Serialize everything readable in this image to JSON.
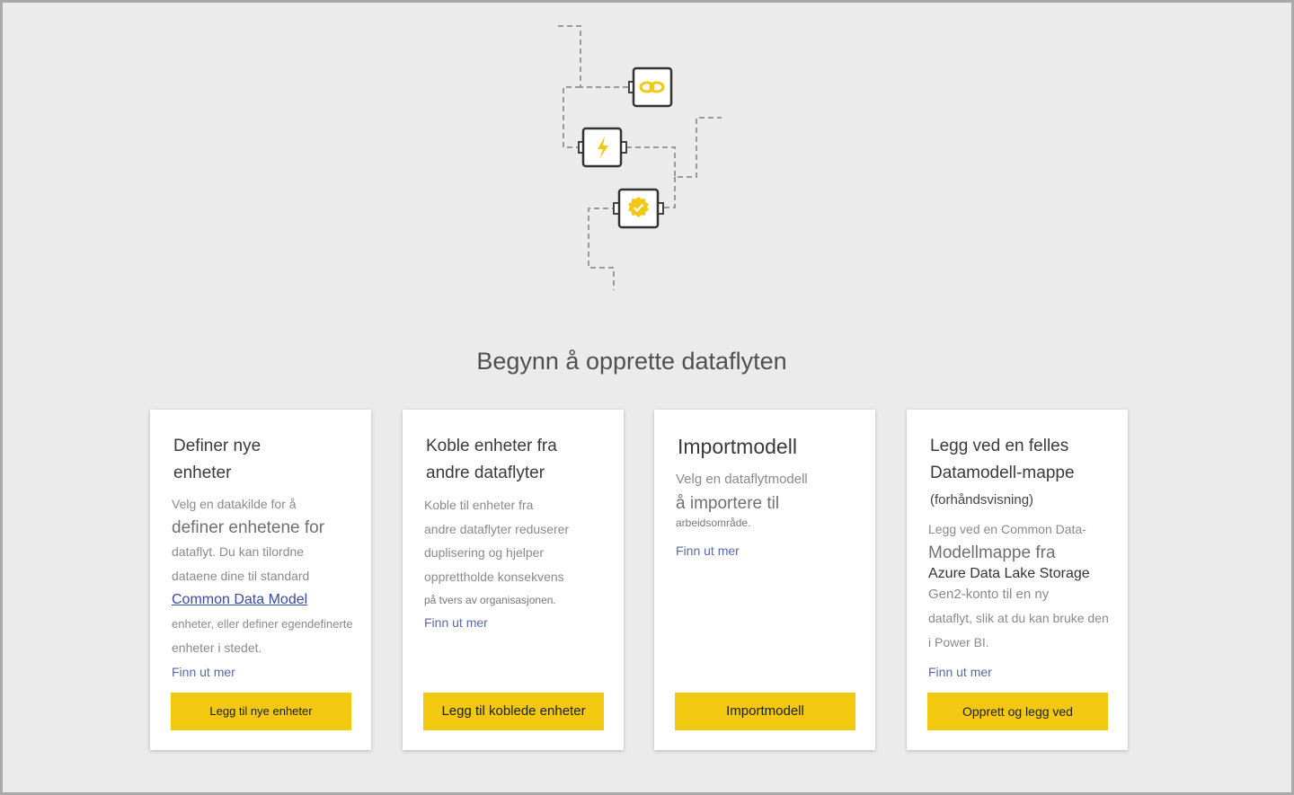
{
  "page": {
    "heading": "Begynn å opprette dataflyten"
  },
  "illustration": {
    "nodes": [
      {
        "icon": "link-icon"
      },
      {
        "icon": "lightning-icon"
      },
      {
        "icon": "checkmark-badge-icon"
      }
    ],
    "accent_color": "#f2c811"
  },
  "cards": [
    {
      "title": "Definer nye enheter",
      "desc_1": "Velg en datakilde for å",
      "desc_2": "definer enhetene for",
      "desc_3": "dataflyt. Du kan tilordne",
      "desc_4": "dataene dine til standard",
      "link_cdm": "Common Data Model",
      "desc_5": "enheter, eller definer egendefinerte",
      "desc_6": "enheter i stedet.",
      "learn_more": "Finn ut mer",
      "button": "Legg til nye enheter"
    },
    {
      "title": "Koble enheter fra andre dataflyter",
      "desc_1": "Koble til enheter fra",
      "desc_2": "andre dataflyter reduserer",
      "desc_3": "duplisering og hjelper",
      "desc_4": "opprettholde konsekvens",
      "desc_5": "på tvers av organisasjonen.",
      "learn_more": "Finn ut mer",
      "button": "Legg til koblede enheter"
    },
    {
      "title": "Importmodell",
      "desc_1": "Velg en dataflytmodell",
      "desc_2": "å importere til",
      "desc_3": "arbeidsområde.",
      "learn_more": "Finn ut mer",
      "button": "Importmodell"
    },
    {
      "title": "Legg ved en felles Datamodell-mappe",
      "title_suffix": "(forhåndsvisning)",
      "desc_1": "Legg ved en Common Data-",
      "desc_2": "Modellmappe fra",
      "desc_3": "Azure Data Lake Storage",
      "desc_4": "Gen2-konto til en ny",
      "desc_5": "dataflyt, slik at du kan bruke den",
      "desc_6": "i Power BI.",
      "learn_more": "Finn ut mer",
      "button": "Opprett og legg ved"
    }
  ],
  "colors": {
    "accent": "#f2c811",
    "background": "#ebebeb",
    "link": "#3c4a9e"
  }
}
